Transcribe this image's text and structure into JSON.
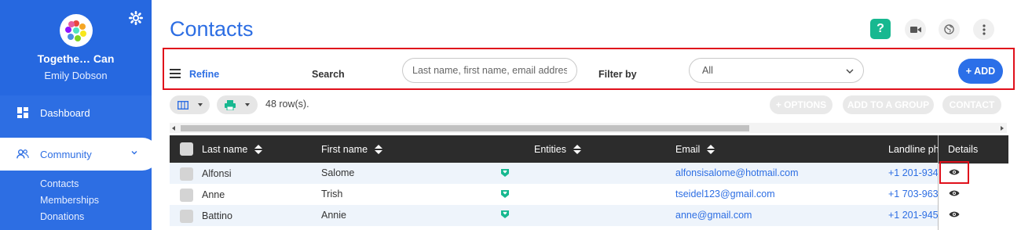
{
  "sidebar": {
    "org_name": "Togethe… Can",
    "user_name": "Emily Dobson",
    "nav": {
      "dashboard": "Dashboard",
      "community": "Community"
    },
    "sub_items": [
      "Contacts",
      "Memberships",
      "Donations"
    ]
  },
  "header": {
    "title": "Contacts",
    "help_label": "?"
  },
  "filters": {
    "refine_label": "Refine",
    "search_label": "Search",
    "search_placeholder": "Last name, first name, email address",
    "filter_label": "Filter by",
    "filter_value": "All",
    "add_label": "+ ADD"
  },
  "toolbar": {
    "row_count": "48 row(s).",
    "options_label": "+ OPTIONS",
    "add_group_label": "ADD TO A GROUP",
    "contact_label": "CONTACT"
  },
  "table": {
    "columns": {
      "last_name": "Last name",
      "first_name": "First name",
      "entities": "Entities",
      "email": "Email",
      "landline": "Landline ph",
      "details": "Details"
    },
    "rows": [
      {
        "last": "Alfonsi",
        "first": "Salome",
        "email": "alfonsisalome@hotmail.com",
        "phone": "+1 201-934"
      },
      {
        "last": "Anne",
        "first": "Trish",
        "email": "tseidel123@gmail.com",
        "phone": "+1 703-963"
      },
      {
        "last": "Battino",
        "first": "Annie",
        "email": "anne@gmail.com",
        "phone": "+1 201-945"
      }
    ]
  },
  "colors": {
    "primary": "#2d6ee3",
    "accent_green": "#17b890",
    "highlight_red": "#e0101b",
    "header_dark": "#2c2c2c"
  }
}
